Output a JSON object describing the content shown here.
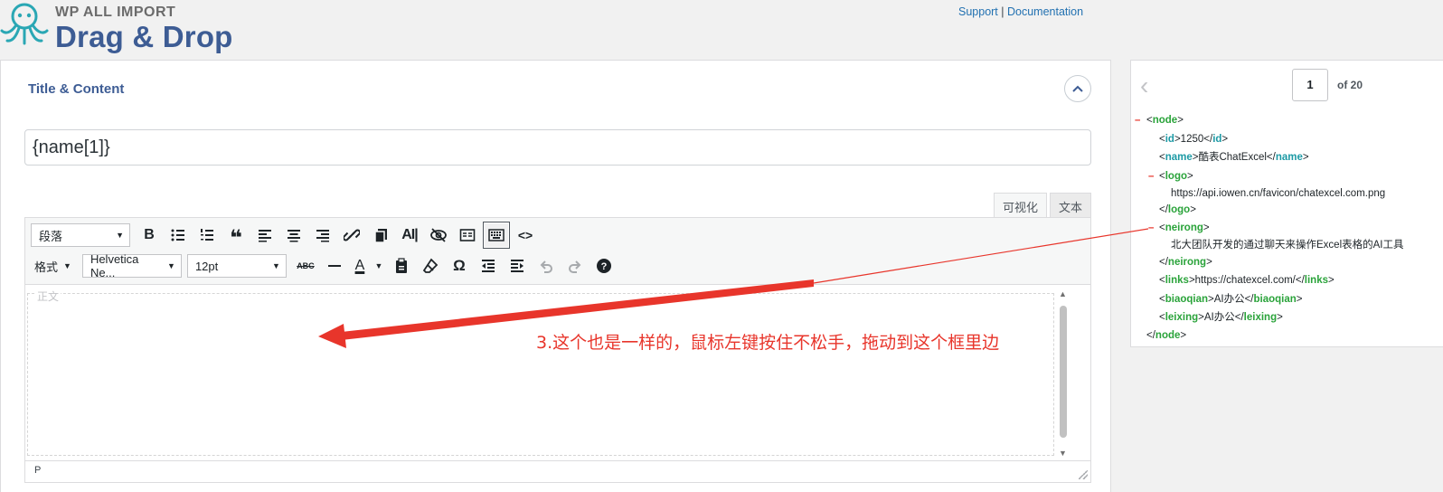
{
  "header": {
    "brand_small": "WP ALL IMPORT",
    "brand_big": "Drag & Drop",
    "support_link": "Support",
    "separator": "|",
    "documentation_link": "Documentation"
  },
  "section": {
    "title": "Title & Content",
    "collapse_icon": "chevron-up-icon"
  },
  "title_input": {
    "value": "{name[1]}"
  },
  "editor": {
    "tabs": [
      "可视化",
      "文本"
    ],
    "paragraph_select": "段落",
    "format_menu": "格式",
    "font_family": "Helvetica Ne...",
    "font_size": "12pt",
    "body_placeholder": "正文",
    "status_path": "P",
    "row1_icons": [
      "bold-icon",
      "bullet-list-icon",
      "numbered-list-icon",
      "blockquote-icon",
      "align-left-icon",
      "align-center-icon",
      "align-right-icon",
      "link-icon",
      "copy-icon",
      "ai-icon",
      "hide-icon",
      "read-more-icon",
      "keyboard-icon",
      "code-icon"
    ],
    "row2_icons": [
      "strikethrough-icon",
      "horizontal-rule-icon",
      "text-color-icon",
      "paste-text-icon",
      "clear-formatting-icon",
      "special-character-icon",
      "outdent-icon",
      "indent-icon",
      "undo-icon",
      "redo-icon",
      "help-icon"
    ]
  },
  "annotation": {
    "text": "3.这个也是一样的，鼠标左键按住不松手，拖动到这个框里边",
    "color": "#e8352b"
  },
  "xml_panel": {
    "page": "1",
    "page_of": "of 20",
    "lines": [
      {
        "indent": 0,
        "toggle": "–",
        "open": "node",
        "text": "",
        "close": "",
        "green": true
      },
      {
        "indent": 1,
        "open": "id",
        "text": "1250",
        "close": "id"
      },
      {
        "indent": 1,
        "open": "name",
        "text": "酷表ChatExcel",
        "close": "name"
      },
      {
        "indent": 1,
        "toggle": "–",
        "open": "logo",
        "text": "",
        "close": "",
        "green": true
      },
      {
        "indent": 2,
        "open": "",
        "text": "https://api.iowen.cn/favicon/chatexcel.com.png",
        "close": ""
      },
      {
        "indent": 1,
        "open": "",
        "text": "",
        "close": "logo",
        "green": true
      },
      {
        "indent": 1,
        "toggle": "–",
        "open": "neirong",
        "text": "",
        "close": "",
        "green": true
      },
      {
        "indent": 2,
        "open": "",
        "text": "北大团队开发的通过聊天来操作Excel表格的AI工具",
        "close": ""
      },
      {
        "indent": 1,
        "open": "",
        "text": "",
        "close": "neirong",
        "green": true
      },
      {
        "indent": 1,
        "open": "links",
        "text": "https://chatexcel.com/",
        "close": "links",
        "green": true
      },
      {
        "indent": 1,
        "open": "biaoqian",
        "text": "AI办公",
        "close": "biaoqian",
        "green": true
      },
      {
        "indent": 1,
        "open": "leixing",
        "text": "AI办公",
        "close": "leixing",
        "green": true
      },
      {
        "indent": 0,
        "open": "",
        "text": "",
        "close": "node",
        "green": true
      }
    ]
  }
}
